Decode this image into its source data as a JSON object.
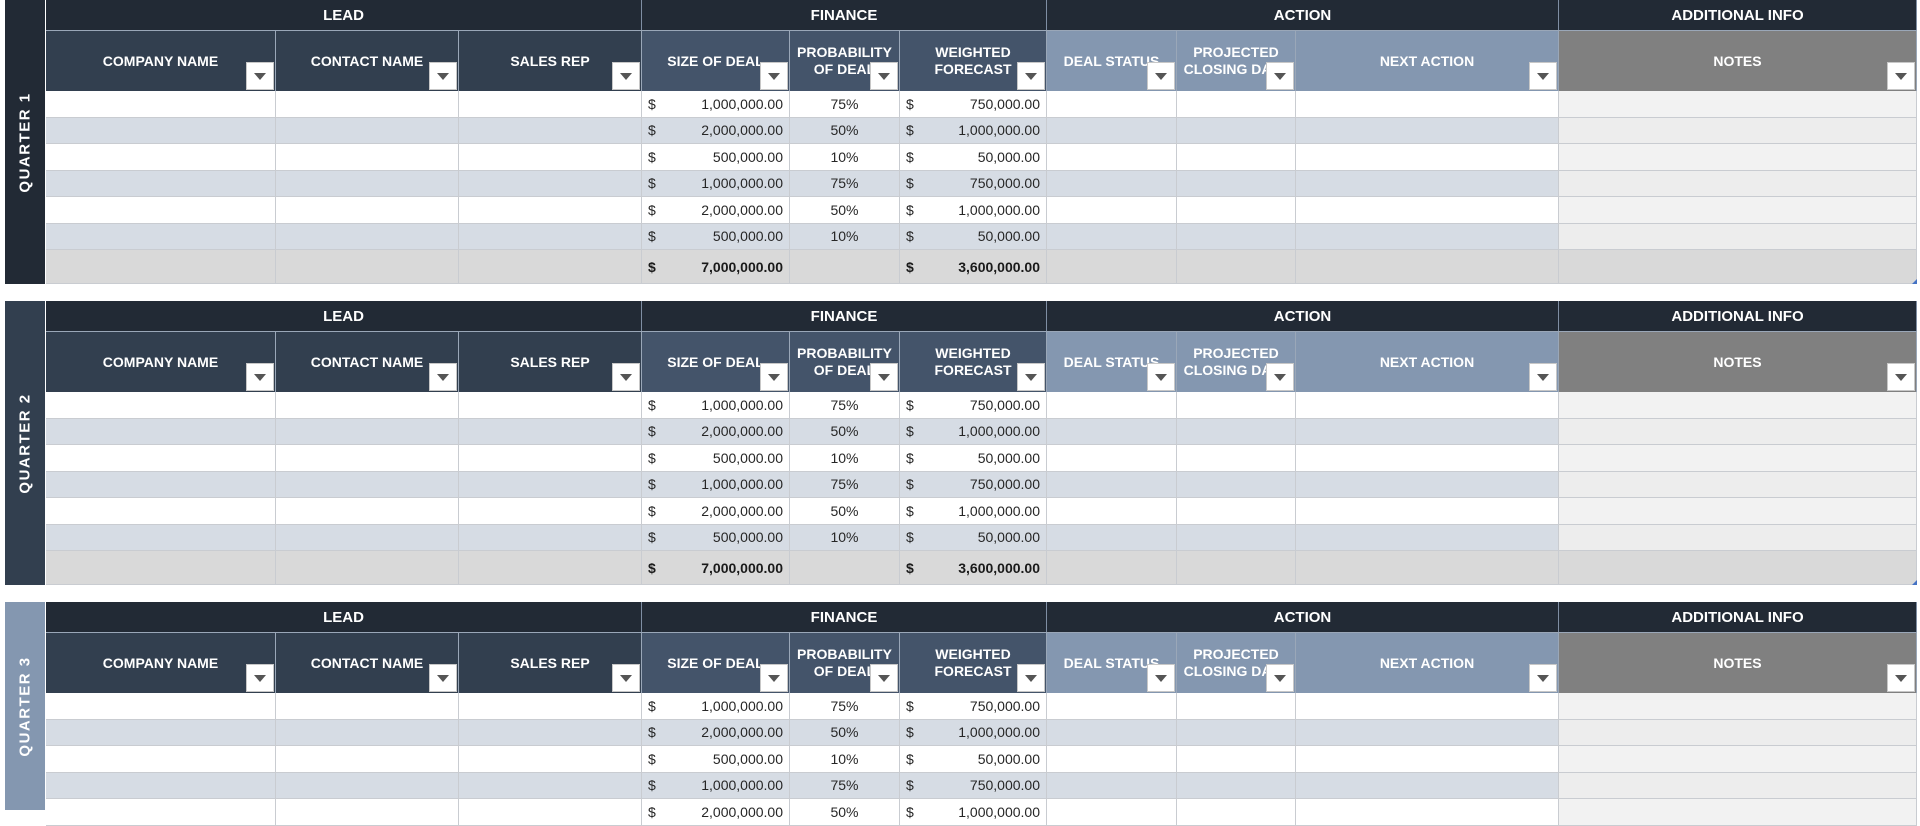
{
  "groups": [
    {
      "key": "lead",
      "label": "LEAD"
    },
    {
      "key": "finance",
      "label": "FINANCE"
    },
    {
      "key": "action",
      "label": "ACTION"
    },
    {
      "key": "additional",
      "label": "ADDITIONAL INFO"
    }
  ],
  "columns": [
    {
      "key": "company",
      "label": "COMPANY NAME",
      "group": "lead"
    },
    {
      "key": "contact",
      "label": "CONTACT NAME",
      "group": "lead"
    },
    {
      "key": "rep",
      "label": "SALES REP",
      "group": "lead"
    },
    {
      "key": "size",
      "label": "SIZE OF DEAL",
      "group": "finance"
    },
    {
      "key": "prob",
      "label": "PROBABILITY\nOF DEAL",
      "group": "finance"
    },
    {
      "key": "weighted",
      "label": "WEIGHTED\nFORECAST",
      "group": "finance"
    },
    {
      "key": "status",
      "label": "DEAL STATUS",
      "group": "action"
    },
    {
      "key": "closing",
      "label": "PROJECTED\nCLOSING DATE",
      "group": "action"
    },
    {
      "key": "next",
      "label": "NEXT ACTION",
      "group": "action"
    },
    {
      "key": "notes",
      "label": "NOTES",
      "group": "additional"
    }
  ],
  "currency_symbol": "$",
  "colors": {
    "lead_header": "#323f4f",
    "finance_header": "#44546a",
    "action_header": "#8497b0",
    "additional_header": "#808080",
    "group_header": "#222a35",
    "row_alt_blue": "#d6dce4",
    "row_alt_gray": "#ededed",
    "total_row": "#d9d9d9"
  },
  "quarters": [
    {
      "label": "QUARTER 1",
      "color": "#222a35",
      "rows": [
        {
          "size": "1,000,000.00",
          "prob": "75%",
          "weighted": "750,000.00"
        },
        {
          "size": "2,000,000.00",
          "prob": "50%",
          "weighted": "1,000,000.00"
        },
        {
          "size": "500,000.00",
          "prob": "10%",
          "weighted": "50,000.00"
        },
        {
          "size": "1,000,000.00",
          "prob": "75%",
          "weighted": "750,000.00"
        },
        {
          "size": "2,000,000.00",
          "prob": "50%",
          "weighted": "1,000,000.00"
        },
        {
          "size": "500,000.00",
          "prob": "10%",
          "weighted": "50,000.00"
        }
      ],
      "total_size": "7,000,000.00",
      "total_weighted": "3,600,000.00"
    },
    {
      "label": "QUARTER 2",
      "color": "#323f4f",
      "rows": [
        {
          "size": "1,000,000.00",
          "prob": "75%",
          "weighted": "750,000.00"
        },
        {
          "size": "2,000,000.00",
          "prob": "50%",
          "weighted": "1,000,000.00"
        },
        {
          "size": "500,000.00",
          "prob": "10%",
          "weighted": "50,000.00"
        },
        {
          "size": "1,000,000.00",
          "prob": "75%",
          "weighted": "750,000.00"
        },
        {
          "size": "2,000,000.00",
          "prob": "50%",
          "weighted": "1,000,000.00"
        },
        {
          "size": "500,000.00",
          "prob": "10%",
          "weighted": "50,000.00"
        }
      ],
      "total_size": "7,000,000.00",
      "total_weighted": "3,600,000.00"
    },
    {
      "label": "QUARTER 3",
      "color": "#8497b0",
      "rows": [
        {
          "size": "1,000,000.00",
          "prob": "75%",
          "weighted": "750,000.00"
        },
        {
          "size": "2,000,000.00",
          "prob": "50%",
          "weighted": "1,000,000.00"
        },
        {
          "size": "500,000.00",
          "prob": "10%",
          "weighted": "50,000.00"
        },
        {
          "size": "1,000,000.00",
          "prob": "75%",
          "weighted": "750,000.00"
        },
        {
          "size": "2,000,000.00",
          "prob": "50%",
          "weighted": "1,000,000.00"
        }
      ]
    }
  ]
}
